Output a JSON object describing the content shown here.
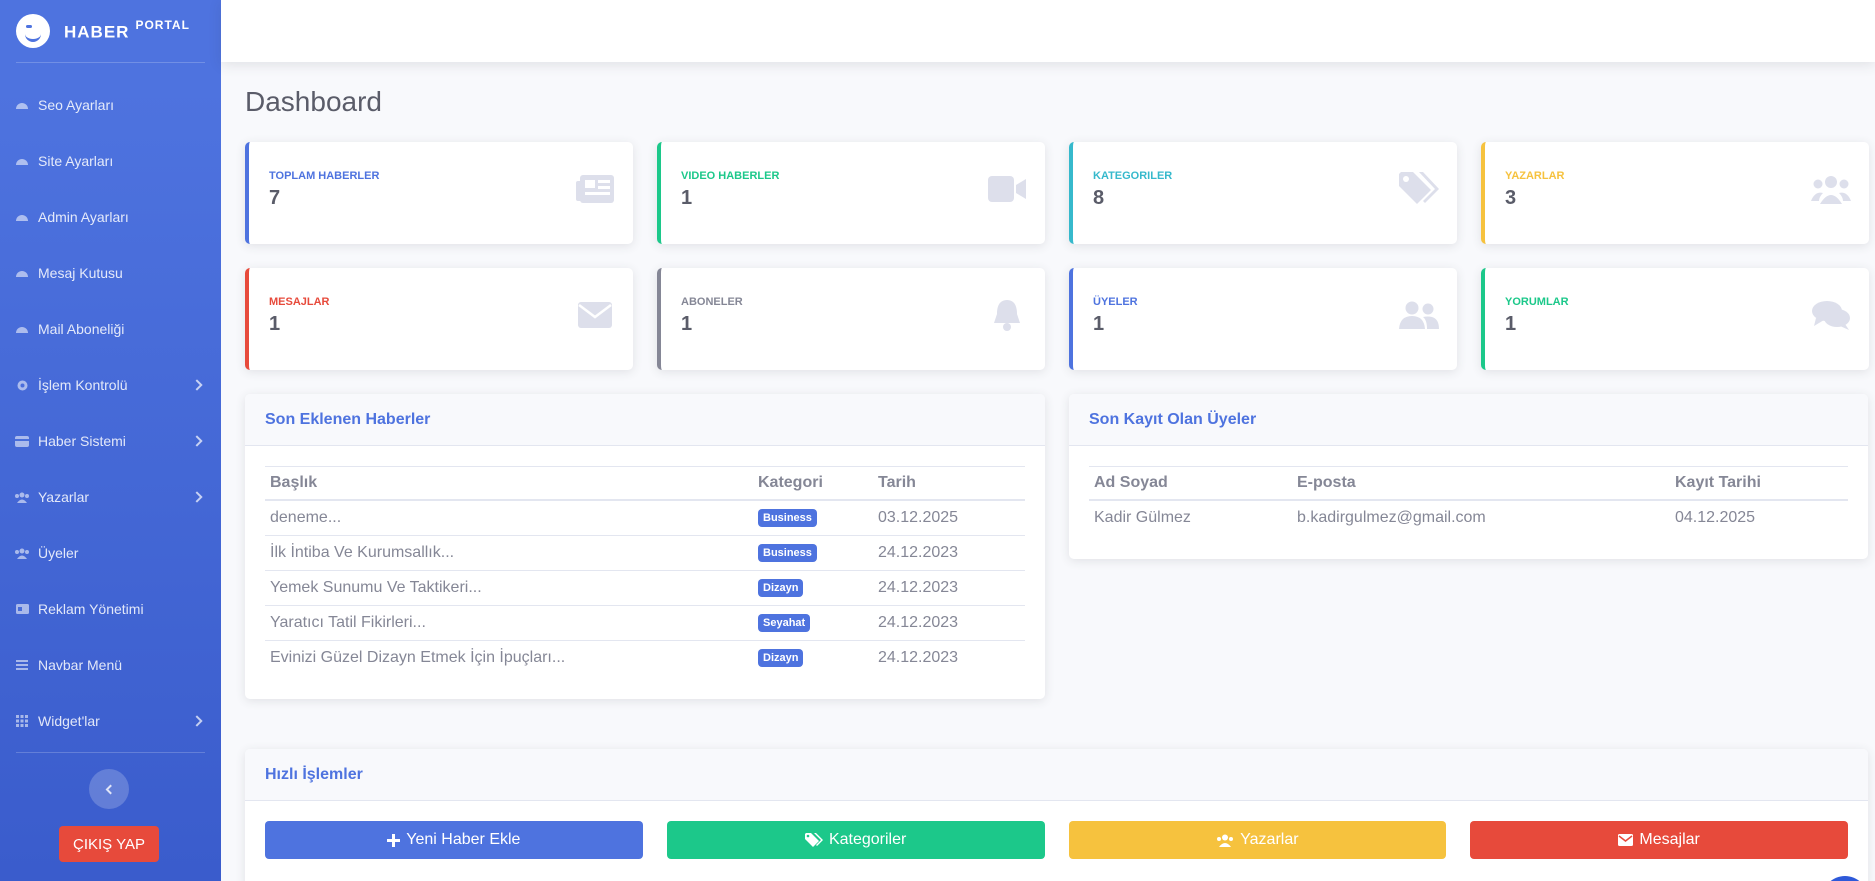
{
  "brand": {
    "name": "HABER",
    "suffix": "PORTAL"
  },
  "sidebar": {
    "items": [
      {
        "label": "Seo Ayarları",
        "icon": "dashboard-icon",
        "has_submenu": false
      },
      {
        "label": "Site Ayarları",
        "icon": "dashboard-icon",
        "has_submenu": false
      },
      {
        "label": "Admin Ayarları",
        "icon": "dashboard-icon",
        "has_submenu": false
      },
      {
        "label": "Mesaj Kutusu",
        "icon": "dashboard-icon",
        "has_submenu": false
      },
      {
        "label": "Mail Aboneliği",
        "icon": "dashboard-icon",
        "has_submenu": false
      },
      {
        "label": "İşlem Kontrolü",
        "icon": "gear-icon",
        "has_submenu": true
      },
      {
        "label": "Haber Sistemi",
        "icon": "card-icon",
        "has_submenu": true
      },
      {
        "label": "Yazarlar",
        "icon": "users-icon",
        "has_submenu": true
      },
      {
        "label": "Üyeler",
        "icon": "users-icon",
        "has_submenu": false
      },
      {
        "label": "Reklam Yönetimi",
        "icon": "ad-icon",
        "has_submenu": false
      },
      {
        "label": "Navbar Menü",
        "icon": "bars-icon",
        "has_submenu": false
      },
      {
        "label": "Widget'lar",
        "icon": "grid-icon",
        "has_submenu": true
      }
    ],
    "logout_label": "ÇIKIŞ YAP"
  },
  "page": {
    "title": "Dashboard"
  },
  "stats": [
    {
      "label": "TOPLAM HABERLER",
      "value": "7",
      "color": "#4e73df",
      "icon": "newspaper-icon"
    },
    {
      "label": "VIDEO HABERLER",
      "value": "1",
      "color": "#1cc88a",
      "icon": "video-icon"
    },
    {
      "label": "KATEGORILER",
      "value": "8",
      "color": "#36b9cc",
      "icon": "tags-icon"
    },
    {
      "label": "YAZARLAR",
      "value": "3",
      "color": "#f6c23e",
      "icon": "users-icon"
    },
    {
      "label": "MESAJLAR",
      "value": "1",
      "color": "#e74a3b",
      "icon": "envelope-icon"
    },
    {
      "label": "ABONELER",
      "value": "1",
      "color": "#858796",
      "icon": "bell-icon"
    },
    {
      "label": "ÜYELER",
      "value": "1",
      "color": "#4e73df",
      "icon": "user-friends-icon"
    },
    {
      "label": "YORUMLAR",
      "value": "1",
      "color": "#1cc88a",
      "icon": "comments-icon"
    }
  ],
  "recent_news": {
    "title": "Son Eklenen Haberler",
    "columns": [
      "Başlık",
      "Kategori",
      "Tarih"
    ],
    "rows": [
      {
        "title": "deneme...",
        "category": "Business",
        "date": "03.12.2025"
      },
      {
        "title": "İlk İntiba Ve Kurumsallık...",
        "category": "Business",
        "date": "24.12.2023"
      },
      {
        "title": "Yemek Sunumu Ve Taktikeri...",
        "category": "Dizayn",
        "date": "24.12.2023"
      },
      {
        "title": "Yaratıcı Tatil Fikirleri...",
        "category": "Seyahat",
        "date": "24.12.2023"
      },
      {
        "title": "Evinizi Güzel Dizayn Etmek İçin İpuçları...",
        "category": "Dizayn",
        "date": "24.12.2023"
      }
    ]
  },
  "recent_members": {
    "title": "Son Kayıt Olan Üyeler",
    "columns": [
      "Ad Soyad",
      "E-posta",
      "Kayıt Tarihi"
    ],
    "rows": [
      {
        "name": "Kadir Gülmez",
        "email": "b.kadirgulmez@gmail.com",
        "date": "04.12.2025"
      }
    ]
  },
  "quick_actions": {
    "title": "Hızlı İşlemler",
    "buttons": [
      {
        "label": "Yeni Haber Ekle",
        "color": "#4e73df",
        "icon": "plus-icon"
      },
      {
        "label": "Kategoriler",
        "color": "#1cc88a",
        "icon": "tags-icon"
      },
      {
        "label": "Yazarlar",
        "color": "#f6c23e",
        "icon": "users-icon"
      },
      {
        "label": "Mesajlar",
        "color": "#e74a3b",
        "icon": "envelope-icon"
      }
    ]
  }
}
